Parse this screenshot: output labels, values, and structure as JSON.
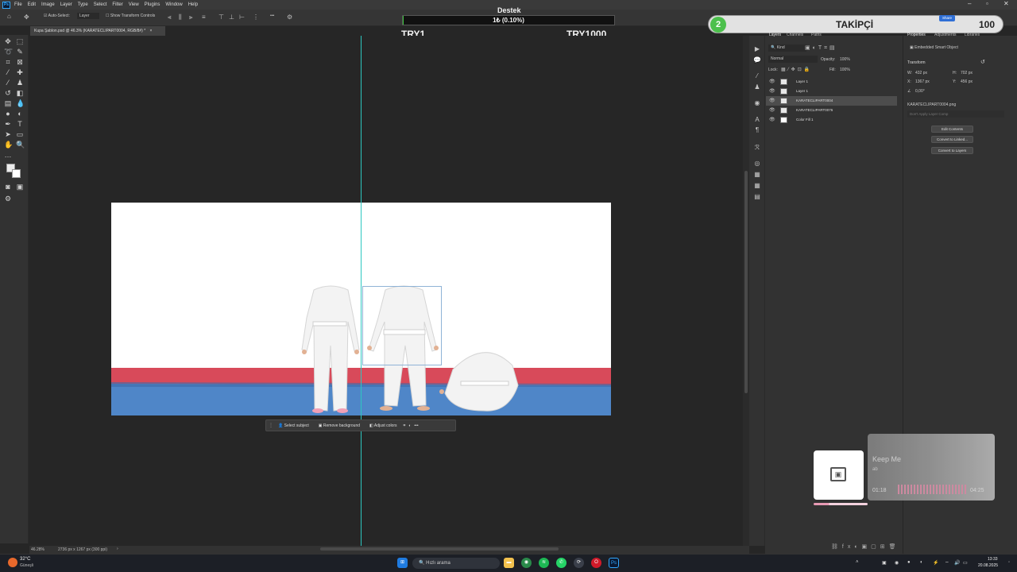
{
  "menubar": {
    "items": [
      "File",
      "Edit",
      "Image",
      "Layer",
      "Type",
      "Select",
      "Filter",
      "View",
      "Plugins",
      "Window",
      "Help"
    ]
  },
  "options": {
    "auto_select_label": "Auto-Select:",
    "auto_select_value": "Layer",
    "transform_controls_label": "Show Transform Controls",
    "more_label": "•••"
  },
  "document": {
    "tab_title": "Kupa Şablon.psd @ 46.3% (KARATECLIPART0004, RGB/8#) *"
  },
  "context_bar": {
    "select_subject": "Select subject",
    "remove_background": "Remove background",
    "adjust_colors": "Adjust colors"
  },
  "status": {
    "zoom": "46.28%",
    "doc_size": "2736 px x 1267 px (300 ppi)"
  },
  "overlay": {
    "donation_title": "Destek",
    "donation_amount": "1₺ (0.10%)",
    "donation_fraction": 0.001,
    "donation_min": "TRY1",
    "donation_max": "TRY1000",
    "follower_count": "2",
    "follower_label": "TAKİPÇİ",
    "follower_goal": "100",
    "share_label": "Share"
  },
  "layers_panel": {
    "tabs": [
      "Layers",
      "Channels",
      "Paths"
    ],
    "kind_label": "Kind",
    "blend_mode": "Normal",
    "opacity_label": "Opacity:",
    "opacity_value": "100%",
    "lock_label": "Lock:",
    "fill_label": "Fill:",
    "fill_value": "100%",
    "layers": [
      {
        "name": "Layer 1",
        "selected": false
      },
      {
        "name": "Layer 1",
        "selected": false
      },
      {
        "name": "KARATECLIPART0004",
        "selected": true
      },
      {
        "name": "KARATECLIPART0076",
        "selected": false
      },
      {
        "name": "Color Fill 1",
        "selected": false
      }
    ]
  },
  "properties": {
    "tabs": [
      "Properties",
      "Adjustments",
      "Libraries"
    ],
    "object_type": "Embedded Smart Object",
    "transform_label": "Transform",
    "w_label": "W:",
    "w_value": "432 px",
    "h_label": "H:",
    "h_value": "702 px",
    "x_label": "X:",
    "x_value": "1367 px",
    "y_label": "Y:",
    "y_value": "456 px",
    "angle_value": "0,00°",
    "filename": "KARATECLIPART0004.png",
    "layer_comp_placeholder": "Don't Apply Layer Comp",
    "buttons": [
      "Edit Contents",
      "Convert to Linked...",
      "Convert to Layers"
    ]
  },
  "music": {
    "title": "Keep Me",
    "artist": "ab",
    "elapsed": "01:18",
    "duration": "04:25",
    "progress": 0.29
  },
  "taskbar": {
    "weather_temp": "32°C",
    "weather_desc": "Güneşli",
    "search_placeholder": "Hızlı arama",
    "time": "13:33",
    "date": "20.08.2025"
  },
  "colors": {
    "guide": "#2dc7c0",
    "follower_green": "#4cc04c",
    "mat_red": "#d84a5a",
    "mat_blue": "#4f86c8",
    "ps_blue": "#31a8ff"
  }
}
